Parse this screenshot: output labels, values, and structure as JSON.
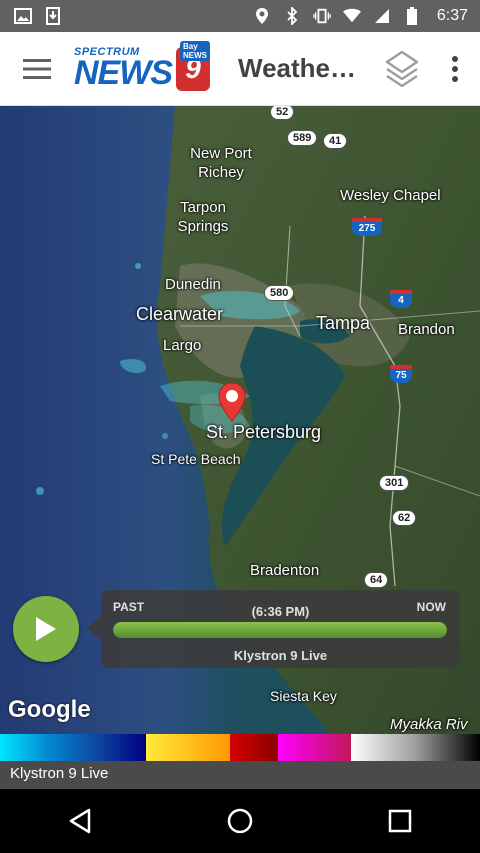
{
  "status_bar": {
    "time": "6:37",
    "icons": [
      "image-icon",
      "download-icon",
      "location-icon",
      "bluetooth-icon",
      "vibrate-icon",
      "wifi-icon",
      "signal-icon",
      "battery-icon"
    ]
  },
  "app_bar": {
    "brand_spectrum": "SPECTRUM",
    "brand_news": "NEWS",
    "brand_nine": "9",
    "brand_bay": "Bay NEWS",
    "title": "Weathe…"
  },
  "map": {
    "places": {
      "new_port_richey": "New Port Richey",
      "wesley_chapel": "Wesley Chapel",
      "tarpon_springs": "Tarpon Springs",
      "dunedin": "Dunedin",
      "clearwater": "Clearwater",
      "tampa": "Tampa",
      "brandon": "Brandon",
      "largo": "Largo",
      "st_petersburg": "St. Petersburg",
      "st_pete_beach": "St Pete Beach",
      "bradenton": "Bradenton",
      "siesta_key": "Siesta Key",
      "myakka": "Myakka Riv"
    },
    "routes": {
      "r52": "52",
      "r589": "589",
      "r41": "41",
      "i275": "275",
      "r580": "580",
      "i4": "4",
      "i75": "75",
      "r301": "301",
      "r62": "62",
      "r64": "64"
    },
    "attribution": "Google"
  },
  "timeline": {
    "past_label": "PAST",
    "time_label": "(6:36 PM)",
    "now_label": "NOW",
    "layer_label": "Klystron 9 Live",
    "progress": 1.0
  },
  "legend": {
    "label": "Klystron 9 Live",
    "colors": [
      "#00e5ff",
      "#0288d1",
      "#0d47a1",
      "#000080",
      "#ffeb3b",
      "#ff9800",
      "#d50000",
      "#8b0000",
      "#ff00ff",
      "#c2185b",
      "#ffffff",
      "#9e9e9e",
      "#000000"
    ]
  },
  "colors": {
    "accent_green": "#7cb342",
    "brand_blue": "#1565c0",
    "brand_red": "#d32f2f"
  }
}
